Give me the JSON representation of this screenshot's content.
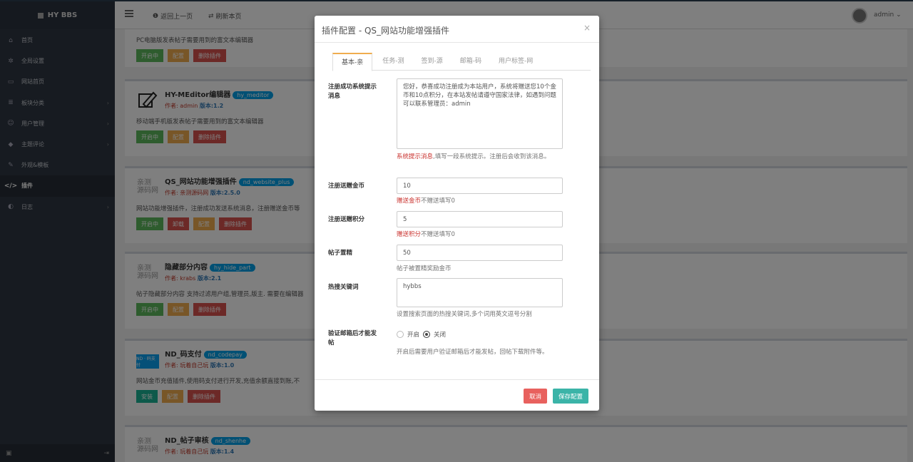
{
  "topbar": {
    "brand": "HY BBS",
    "back_label": "返回上一页",
    "refresh_label": "刷新本页",
    "user": "admin"
  },
  "sidebar": {
    "items": [
      {
        "label": "首页",
        "icon": "home-icon",
        "arrow": false
      },
      {
        "label": "全局设置",
        "icon": "gear-icon",
        "arrow": false
      },
      {
        "label": "网站首页",
        "icon": "monitor-icon",
        "arrow": false
      },
      {
        "label": "板块分类",
        "icon": "list-icon",
        "arrow": true
      },
      {
        "label": "用户管理",
        "icon": "users-icon",
        "arrow": true
      },
      {
        "label": "主题评论",
        "icon": "tag-icon",
        "arrow": true
      },
      {
        "label": "外观&模板",
        "icon": "brush-icon",
        "arrow": false
      },
      {
        "label": "插件",
        "icon": "code-icon",
        "arrow": false,
        "active": true
      },
      {
        "label": "日志",
        "icon": "log-icon",
        "arrow": true
      }
    ]
  },
  "plugins": {
    "p0": {
      "desc": "PC电脑版发表帖子需要用到的富文本编辑器",
      "on": "开启中",
      "cfg": "配置",
      "del": "删除插件"
    },
    "p1": {
      "name": "HY-MEditor编辑器",
      "tag": "hy_meditor",
      "author": "作者: admin",
      "version": "版本:1.2",
      "desc": "移动端手机版发表帖子需要用到的富文本编辑器",
      "on": "开启中",
      "cfg": "配置",
      "del": "删除插件"
    },
    "p2": {
      "name": "QS_网站功能增强插件",
      "tag": "nd_website_plus",
      "author": "作者: 亲测源码网",
      "version": "版本:2.5.0",
      "desc": "网站功能增强插件，注册成功发送系统消息，注册赠送金币等",
      "on": "开启中",
      "unload": "卸载",
      "cfg": "配置",
      "del": "删除插件",
      "logo1": "亲测",
      "logo2": "源码网"
    },
    "p3": {
      "name": "隐藏部分内容",
      "tag": "hy_hide_part",
      "author": "作者: krabs",
      "version": "版本:2.1",
      "desc": "帖子隐藏部分内容 支持过滤用户组,管理员,版主. 需要在编辑器",
      "on": "开启中",
      "cfg": "配置",
      "del": "删除插件",
      "logo1": "亲测",
      "logo2": "源码网"
    },
    "p4": {
      "name": "ND_码支付",
      "tag": "nd_codepay",
      "author": "作者: 玩着自己玩",
      "version": "版本:1.0",
      "desc": "网站金币充值插件,使用码支付进行开发,充值余额直接到账,不",
      "install": "安装",
      "cfg": "配置",
      "del": "删除插件",
      "logo": "ND · 码支付"
    },
    "p5": {
      "name": "ND_帖子审核",
      "tag": "nd_shenhe",
      "author": "作者: 玩着自己玩",
      "version": "版本:1.4",
      "logo1": "亲测",
      "logo2": "源码网"
    }
  },
  "modal": {
    "title": "插件配置 - QS_网站功能增强插件",
    "close": "×",
    "tabs": [
      "基本-亲",
      "任务-测",
      "签到-源",
      "邮箱-码",
      "用户标签-网"
    ],
    "f1": {
      "label": "注册成功系统提示消息",
      "value": "您好，恭喜成功注册成为本站用户，系统将赠送您10个金币和10点积分，在本站发帖请遵守国家法律，如遇到问题可以联系管理员：admin",
      "help_red": "系统提示消息",
      "help": ",填写一段系统提示。注册后会收到该消息。"
    },
    "f2": {
      "label": "注册送赠金币",
      "value": "10",
      "help_red": "赠送金币",
      "help": "不赠送填写0"
    },
    "f3": {
      "label": "注册送赠积分",
      "value": "5",
      "help_red": "赠送积分",
      "help": "不赠送填写0"
    },
    "f4": {
      "label": "帖子置精",
      "value": "50",
      "help": "帖子被置精奖励金币"
    },
    "f5": {
      "label": "热搜关键词",
      "value": "hybbs",
      "help": "设置搜索页面的热搜关键词,多个词用英文逗号分割"
    },
    "f6": {
      "label": "验证邮箱后才能发帖",
      "opt_on": "开启",
      "opt_off": "关闭",
      "selected": "关闭",
      "help": "开启后需要用户验证邮箱后才能发帖，回帖下载附件等。"
    },
    "cancel": "取消",
    "save": "保存配置"
  },
  "colors": {
    "sidebar": "#2f3742",
    "cancel": "#e8615e",
    "save": "#3bb4a8",
    "tab_accent": "#f0ad4e"
  }
}
